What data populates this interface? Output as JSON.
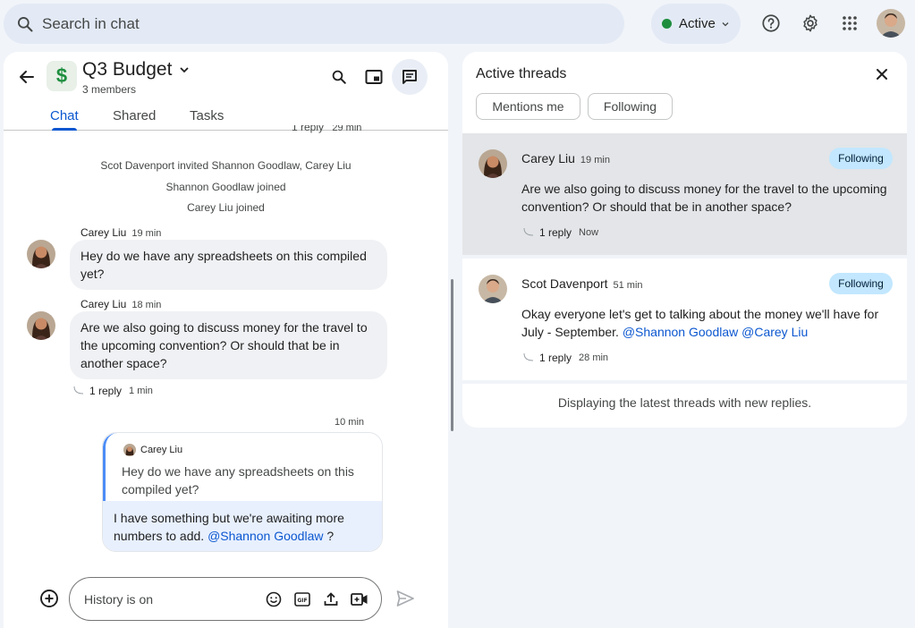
{
  "search": {
    "placeholder": "Search in chat"
  },
  "status": {
    "label": "Active",
    "color": "#1e8e3e"
  },
  "top_icons": [
    "help-icon",
    "settings-gear-icon",
    "apps-grid-icon",
    "account-avatar"
  ],
  "space": {
    "icon_glyph": "$",
    "title": "Q3 Budget",
    "members": "3 members",
    "tabs": [
      {
        "label": "Chat",
        "selected": true
      },
      {
        "label": "Shared",
        "selected": false
      },
      {
        "label": "Tasks",
        "selected": false
      }
    ]
  },
  "chat": {
    "clipped_reply": {
      "count": "1 reply",
      "time": "29 min"
    },
    "system_messages": [
      "Scot Davenport invited Shannon Goodlaw, Carey Liu",
      "Shannon Goodlaw joined",
      "Carey Liu joined"
    ],
    "messages": [
      {
        "author": "Carey Liu",
        "time": "19 min",
        "text": "Hey do we have any spreadsheets on this compiled yet?"
      },
      {
        "author": "Carey Liu",
        "time": "18 min",
        "text": "Are we also going to discuss money for the travel to the upcoming convention? Or should that be in another space?",
        "reply_count": "1 reply",
        "reply_time": "1 min"
      }
    ],
    "own_message": {
      "time": "10 min",
      "quoted_author": "Carey Liu",
      "quoted_text": "Hey do we have any spreadsheets on this compiled yet?",
      "text": "I have something but we're awaiting more numbers to add.",
      "mention": "@Shannon Goodlaw",
      "suffix": " ?"
    }
  },
  "composer": {
    "placeholder": "History is on"
  },
  "threads": {
    "title": "Active threads",
    "filters": [
      "Mentions me",
      "Following"
    ],
    "items": [
      {
        "author": "Carey Liu",
        "time": "19 min",
        "badge": "Following",
        "text": "Are we also going to discuss money for the travel to the upcoming convention? Or should that be in another space?",
        "reply_count": "1 reply",
        "reply_time": "Now"
      },
      {
        "author": "Scot Davenport",
        "time": "51 min",
        "badge": "Following",
        "text": "Okay everyone let's get to talking about the money we'll have for July - September.",
        "mentions": "@Shannon Goodlaw @Carey Liu",
        "reply_count": "1 reply",
        "reply_time": "28 min"
      }
    ],
    "footer": "Displaying the latest threads with new replies."
  },
  "colors": {
    "accent": "#0b57d0",
    "badge_bg": "#c2e7ff",
    "highlight_row": "#e3e5e8",
    "quote_bar": "#4c8df6"
  }
}
